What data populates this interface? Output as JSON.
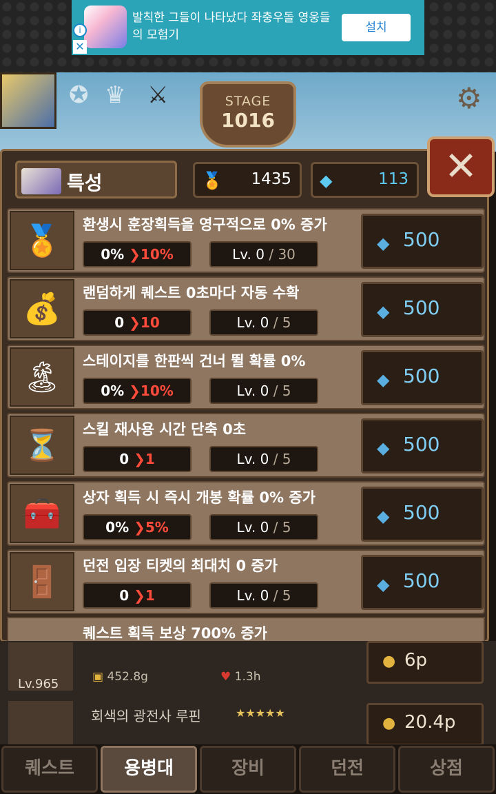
{
  "ad": {
    "text": "발칙한 그들이 나타났다 좌충우돌 영웅들의 모험기",
    "button": "설치"
  },
  "stage": {
    "label": "STAGE",
    "number": "1016"
  },
  "panel": {
    "title": "특성",
    "medals": "1435",
    "gems": "113"
  },
  "traits": [
    {
      "icon": "medal-icon",
      "desc": "환생시 훈장획득을 영구적으로 0% 증가",
      "from": "0%",
      "to": "10%",
      "lv": "Lv. 0",
      "max": "/ 30",
      "price": "500"
    },
    {
      "icon": "money-bag-icon",
      "desc": "랜덤하게 퀘스트 0초마다 자동 수확",
      "from": "0",
      "to": "10",
      "lv": "Lv. 0",
      "max": "/ 5",
      "price": "500"
    },
    {
      "icon": "island-icon",
      "desc": "스테이지를 한판씩 건너 뛸 확률 0%",
      "from": "0%",
      "to": "10%",
      "lv": "Lv. 0",
      "max": "/ 5",
      "price": "500"
    },
    {
      "icon": "hourglass-icon",
      "desc": "스킬 재사용 시간 단축 0초",
      "from": "0",
      "to": "1",
      "lv": "Lv. 0",
      "max": "/ 5",
      "price": "500"
    },
    {
      "icon": "chest-icon",
      "desc": "상자 획득 시 즉시 개봉 확률 0% 증가",
      "from": "0%",
      "to": "5%",
      "lv": "Lv. 0",
      "max": "/ 5",
      "price": "500"
    },
    {
      "icon": "gate-icon",
      "desc": "던전 입장 티켓의 최대치 0 증가",
      "from": "0",
      "to": "1",
      "lv": "Lv. 0",
      "max": "/ 5",
      "price": "500"
    }
  ],
  "partial_trait": "퀘스트 획득 보상 700% 증가",
  "mercenaries": [
    {
      "name": "",
      "level": "Lv.965",
      "atk": "452.8g",
      "hp": "1.3h",
      "cost": "6p"
    },
    {
      "name": "회색의 광전사 루핀",
      "stars": "★★★★★",
      "cost": "20.4p"
    }
  ],
  "nav": [
    "퀘스트",
    "용병대",
    "장비",
    "던전",
    "상점"
  ]
}
